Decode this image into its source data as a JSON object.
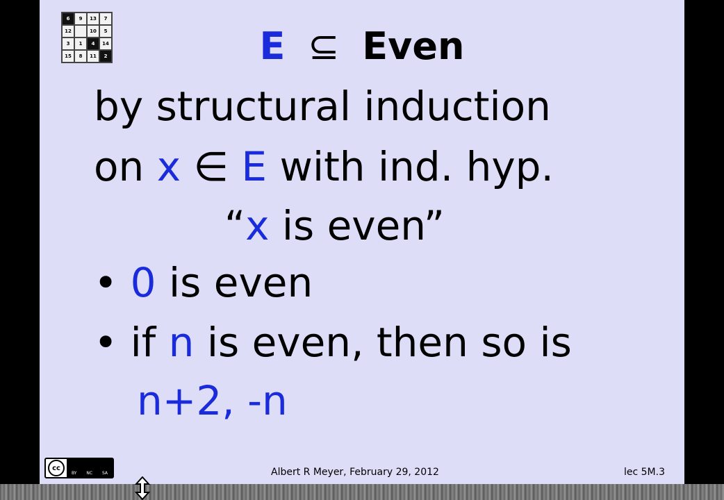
{
  "slide": {
    "title": {
      "left": "E",
      "op": "⊆",
      "right": "Even"
    },
    "line1": "by structural induction",
    "line2": {
      "a": "on ",
      "x": "x",
      "in": " ∈ ",
      "E": "E",
      "rest": " with ind. hyp."
    },
    "line3": {
      "open": "“",
      "x": "x",
      "rest": " is even”"
    },
    "bullet1": {
      "dot": "• ",
      "zero": "0",
      "rest": " is even"
    },
    "bullet2": {
      "dot": "• ",
      "a": "if ",
      "n": "n",
      "rest": " is even, then so is"
    },
    "line_last": "n+2, -n",
    "footer": {
      "author": "Albert R Meyer,   February 29, 2012",
      "lecture": "lec 5M.3"
    },
    "license": {
      "cc": "cc",
      "terms": [
        "BY",
        "NC",
        "SA"
      ]
    },
    "puzzle": [
      "6",
      "9",
      "13",
      "7",
      "12",
      "",
      "10",
      "5",
      "3",
      "1",
      "4",
      "14",
      "15",
      "8",
      "11",
      "2"
    ]
  },
  "colors": {
    "slide_bg": "#ddddf8",
    "accent_blue": "#1a2bdc"
  }
}
